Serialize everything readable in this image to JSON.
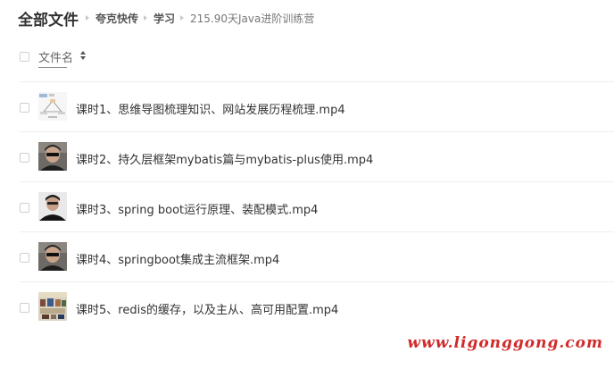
{
  "breadcrumb": {
    "root": "全部文件",
    "items": [
      "夸克快传",
      "学习",
      "215.90天Java进阶训练营"
    ]
  },
  "list_header": {
    "column_label": "文件名",
    "sort_icon": "sort-updown-icon"
  },
  "files": [
    {
      "name": "课时1、思维导图梳理知识、网站发展历程梳理.mp4",
      "thumb": "diagram-thumbnail"
    },
    {
      "name": "课时2、持久层框架mybatis篇与mybatis-plus使用.mp4",
      "thumb": "person-thumbnail"
    },
    {
      "name": "课时3、spring boot运行原理、装配模式.mp4",
      "thumb": "person-thumbnail"
    },
    {
      "name": "课时4、springboot集成主流框架.mp4",
      "thumb": "person-thumbnail"
    },
    {
      "name": "课时5、redis的缓存，以及主从、高可用配置.mp4",
      "thumb": "slide-thumbnail"
    }
  ],
  "watermark": "www.ligonggong.com",
  "colors": {
    "watermark": "#d12a2a",
    "divider": "#eeeeee",
    "text": "#333333"
  }
}
